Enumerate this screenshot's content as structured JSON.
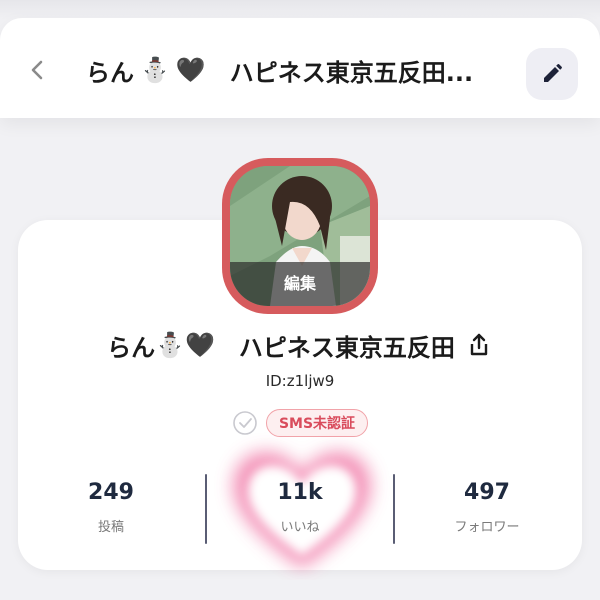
{
  "header": {
    "title_name": "らん",
    "title_emojis": [
      "⛄",
      "🖤"
    ],
    "title_shop": "ハピネス東京五反田...",
    "back_icon": "chevron-left-icon",
    "edit_icon": "pencil-icon"
  },
  "profile": {
    "avatar_edit_label": "編集",
    "name": "らん",
    "name_emojis": [
      "⛄",
      "🖤"
    ],
    "shop": "ハピネス東京五反田",
    "user_id": "ID:z1ljw9",
    "sms_badge": "SMS未認証"
  },
  "stats": [
    {
      "value": "249",
      "label": "投稿"
    },
    {
      "value": "11k",
      "label": "いいね"
    },
    {
      "value": "497",
      "label": "フォロワー"
    }
  ],
  "colors": {
    "avatar_border": "#d65b5d",
    "sms_badge_text": "#d94c5c",
    "stat_number": "#1f2a3f"
  }
}
